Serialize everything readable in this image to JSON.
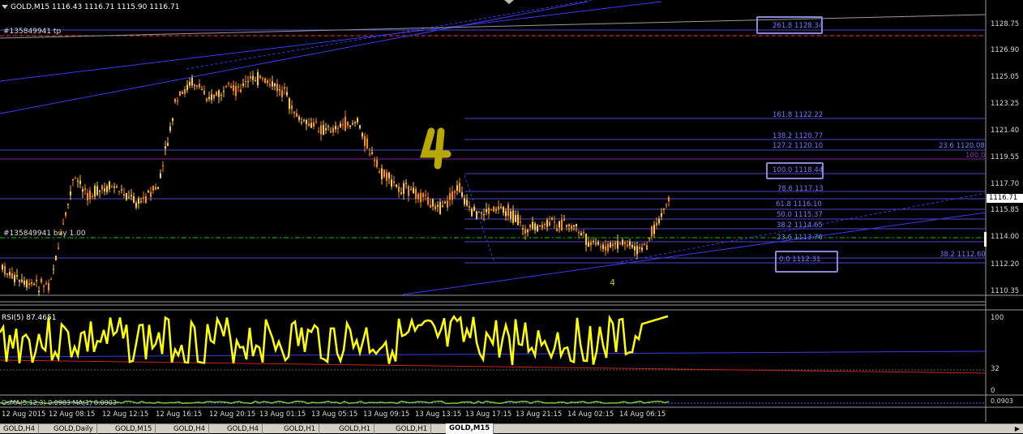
{
  "chart_header": {
    "symbol": "GOLD,M15",
    "ohlc": "1116.43 1116.71 1115.90 1116.71"
  },
  "order_labels": {
    "tp": "#135849941 tp",
    "buy": "#135849941 buy 1.00"
  },
  "price_axis": [
    "1128.75",
    "1126.90",
    "1125.05",
    "1123.25",
    "1121.40",
    "1119.55",
    "1117.70",
    "1115.85",
    "1114.00",
    "1112.20",
    "1110.35"
  ],
  "current_price": "1116.71",
  "fib_levels_right": [
    {
      "text": "261.8 1128.34"
    },
    {
      "text": "161.8 1122.22"
    },
    {
      "text": "138.2 1120.77"
    },
    {
      "text": "127.2 1120.10"
    },
    {
      "text": "100.0 1118.44"
    },
    {
      "text": "78.6 1117.13"
    },
    {
      "text": "61.8 1116.10"
    },
    {
      "text": "50.0 1115.37"
    },
    {
      "text": "38.2 1114.65"
    },
    {
      "text": "23.6 1113.76"
    },
    {
      "text": "0.0 1112.31"
    }
  ],
  "fib_levels_far": [
    {
      "text": "23.6 1120.08"
    },
    {
      "text": "100.0"
    },
    {
      "text": "38.2 1112.60"
    }
  ],
  "wave_label": "4",
  "rsi": {
    "title": "RSI(5) 87.4651",
    "axis": [
      "100",
      "32",
      "0"
    ]
  },
  "osma": {
    "title": "OsMA(5,12,3) 0.0903 MA(1) 0.0903",
    "axis": "0.0903"
  },
  "time_axis": [
    "12 Aug 2015",
    "12 Aug 08:15",
    "12 Aug 12:15",
    "12 Aug 16:15",
    "12 Aug 20:15",
    "13 Aug 01:15",
    "13 Aug 05:15",
    "13 Aug 09:15",
    "13 Aug 13:15",
    "13 Aug 17:15",
    "13 Aug 21:15",
    "14 Aug 02:15",
    "14 Aug 06:15"
  ],
  "tabs": [
    "GOLD,H4",
    "GOLD,Daily",
    "GOLD,M15",
    "GOLD,H4",
    "GOLD,H4",
    "GOLD,H1",
    "GOLD,H1",
    "GOLD,H1",
    "GOLD,M15"
  ],
  "active_tab": 8,
  "colors": {
    "up_candle": "#ffcc33",
    "down_candle": "#ff8c00",
    "rsi_line": "#ffff00",
    "fib": "#6c7cff",
    "tp_line": "#ff3030",
    "buy_line": "#00cc00"
  }
}
